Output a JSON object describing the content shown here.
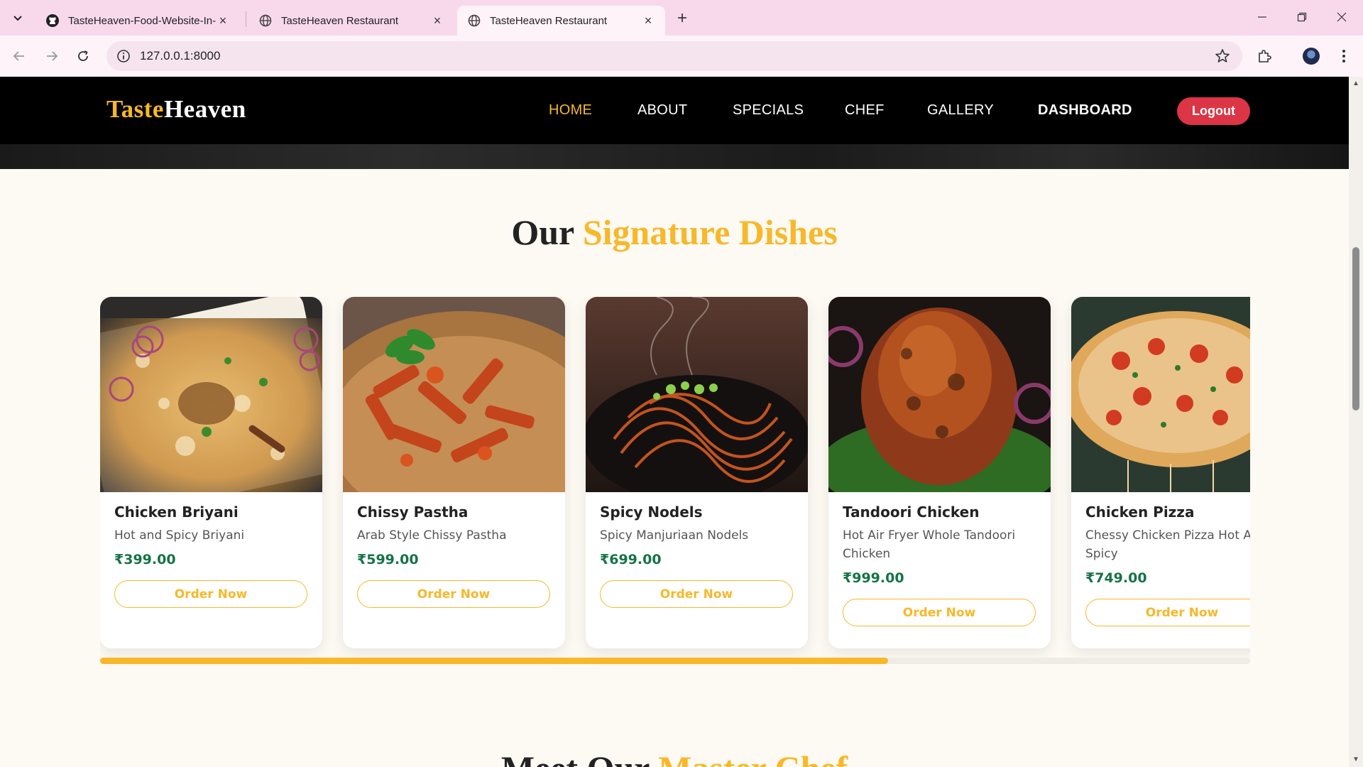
{
  "browser": {
    "tabs": [
      {
        "title": "TasteHeaven-Food-Website-In-I",
        "favicon": "github-icon",
        "active": false
      },
      {
        "title": "TasteHeaven Restaurant",
        "favicon": "globe-icon",
        "active": false
      },
      {
        "title": "TasteHeaven Restaurant",
        "favicon": "globe-icon",
        "active": true
      }
    ],
    "url": "127.0.0.1:8000"
  },
  "site": {
    "logo": {
      "part1": "Taste",
      "part2": "Heaven"
    },
    "nav": [
      {
        "label": "HOME",
        "active": true
      },
      {
        "label": "ABOUT",
        "active": false
      },
      {
        "label": "SPECIALS",
        "active": false
      },
      {
        "label": "CHEF",
        "active": false
      },
      {
        "label": "GALLERY",
        "active": false
      },
      {
        "label": "DASHBOARD",
        "active": false
      }
    ],
    "logout_label": "Logout"
  },
  "signature": {
    "title_plain": "Our",
    "title_accent": "Signature Dishes",
    "dishes": [
      {
        "name": "Chicken Briyani",
        "desc": "Hot and Spicy Briyani",
        "price": "₹399.00",
        "cta": "Order Now"
      },
      {
        "name": "Chissy Pastha",
        "desc": "Arab Style Chissy Pastha",
        "price": "₹599.00",
        "cta": "Order Now"
      },
      {
        "name": "Spicy Nodels",
        "desc": "Spicy Manjuriaan Nodels",
        "price": "₹699.00",
        "cta": "Order Now"
      },
      {
        "name": "Tandoori Chicken",
        "desc": "Hot Air Fryer Whole Tandoori Chicken",
        "price": "₹999.00",
        "cta": "Order Now"
      },
      {
        "name": "Chicken Pizza",
        "desc": "Chessy Chicken Pizza Hot And Spicy",
        "price": "₹749.00",
        "cta": "Order Now"
      }
    ],
    "scroll_progress": 0.685
  },
  "chef": {
    "title_plain": "Meet Our",
    "title_accent": "Master Chef"
  },
  "colors": {
    "accent": "#f7b829",
    "price": "#157347",
    "logout": "#dc3545"
  }
}
